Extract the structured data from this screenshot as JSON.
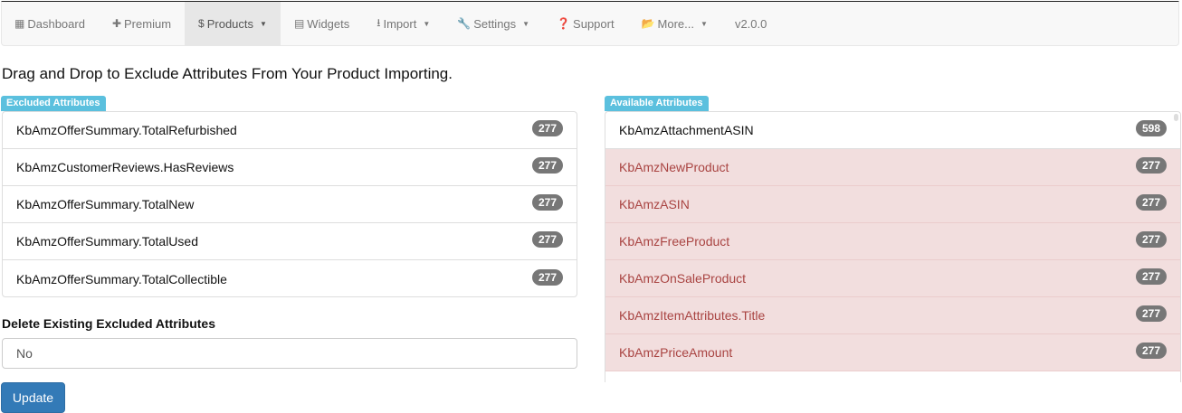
{
  "nav": [
    {
      "icon": "grid-icon",
      "glyph": "▦",
      "label": "Dashboard",
      "caret": false,
      "active": false
    },
    {
      "icon": "plus-icon",
      "glyph": "✚",
      "label": "Premium",
      "caret": false,
      "active": false
    },
    {
      "icon": "dollar-icon",
      "glyph": "$",
      "label": "Products",
      "caret": true,
      "active": true
    },
    {
      "icon": "list-icon",
      "glyph": "▤",
      "label": "Widgets",
      "caret": false,
      "active": false
    },
    {
      "icon": "import-icon",
      "glyph": "⭳",
      "label": "Import",
      "caret": true,
      "active": false
    },
    {
      "icon": "wrench-icon",
      "glyph": "🔧",
      "label": "Settings",
      "caret": true,
      "active": false
    },
    {
      "icon": "question-icon",
      "glyph": "❓",
      "label": "Support",
      "caret": false,
      "active": false
    },
    {
      "icon": "folder-open-icon",
      "glyph": "📂",
      "label": "More...",
      "caret": true,
      "active": false
    },
    {
      "icon": "",
      "glyph": "",
      "label": "v2.0.0",
      "caret": false,
      "active": false
    }
  ],
  "heading": "Drag and Drop to Exclude Attributes From Your Product Importing.",
  "excluded": {
    "label": "Excluded Attributes",
    "items": [
      {
        "name": "KbAmzOfferSummary.TotalRefurbished",
        "count": "277"
      },
      {
        "name": "KbAmzCustomerReviews.HasReviews",
        "count": "277"
      },
      {
        "name": "KbAmzOfferSummary.TotalNew",
        "count": "277"
      },
      {
        "name": "KbAmzOfferSummary.TotalUsed",
        "count": "277"
      },
      {
        "name": "KbAmzOfferSummary.TotalCollectible",
        "count": "277"
      }
    ]
  },
  "available": {
    "label": "Available Attributes",
    "items": [
      {
        "name": "KbAmzAttachmentASIN",
        "count": "598",
        "highlight": false
      },
      {
        "name": "KbAmzNewProduct",
        "count": "277",
        "highlight": true
      },
      {
        "name": "KbAmzASIN",
        "count": "277",
        "highlight": true
      },
      {
        "name": "KbAmzFreeProduct",
        "count": "277",
        "highlight": true
      },
      {
        "name": "KbAmzOnSaleProduct",
        "count": "277",
        "highlight": true
      },
      {
        "name": "KbAmzItemAttributes.Title",
        "count": "277",
        "highlight": true
      },
      {
        "name": "KbAmzPriceAmount",
        "count": "277",
        "highlight": true
      },
      {
        "name": "",
        "count": "",
        "highlight": false
      }
    ]
  },
  "delete_label": "Delete Existing Excluded Attributes",
  "delete_value": "No",
  "update_label": "Update"
}
